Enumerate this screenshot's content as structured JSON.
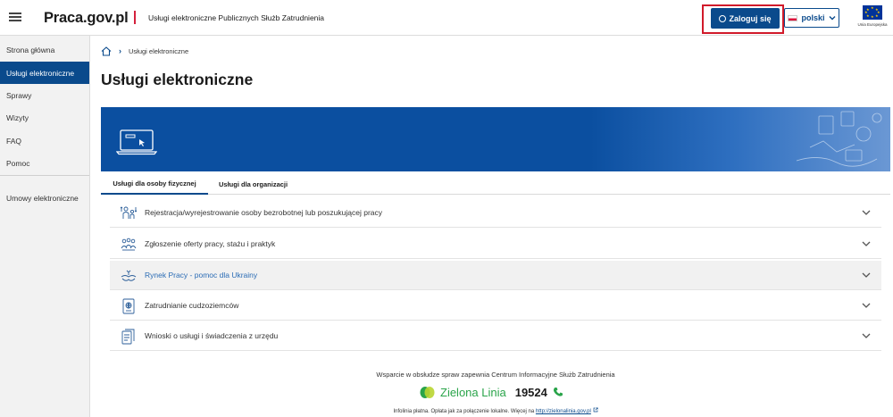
{
  "header": {
    "logo": "Praca.gov.pl",
    "subtitle": "Usługi elektroniczne Publicznych Służb Zatrudnienia",
    "login_label": "Zaloguj się",
    "language_label": "polski",
    "eu_label": "Unia Europejska"
  },
  "sidebar": {
    "items": [
      {
        "label": "Strona główna"
      },
      {
        "label": "Usługi elektroniczne"
      },
      {
        "label": "Sprawy"
      },
      {
        "label": "Wizyty"
      },
      {
        "label": "FAQ"
      },
      {
        "label": "Pomoc"
      },
      {
        "label": "Umowy elektroniczne"
      }
    ],
    "active_index": 1
  },
  "breadcrumb": {
    "current": "Usługi elektroniczne"
  },
  "main": {
    "title": "Usługi elektroniczne",
    "tabs": [
      {
        "label": "Usługi dla osoby fizycznej"
      },
      {
        "label": "Usługi dla organizacji"
      }
    ],
    "active_tab": 0,
    "services": [
      {
        "label": "Rejestracja/wyrejestrowanie osoby bezrobotnej lub poszukującej pracy",
        "icon": "people-arrows-icon"
      },
      {
        "label": "Zgłoszenie oferty pracy, stażu i praktyk",
        "icon": "people-group-icon"
      },
      {
        "label": "Rynek Pracy - pomoc dla Ukrainy",
        "icon": "helping-hands-icon"
      },
      {
        "label": "Zatrudnianie cudzoziemców",
        "icon": "passport-icon"
      },
      {
        "label": "Wnioski o usługi i świadczenia z urzędu",
        "icon": "documents-icon"
      }
    ],
    "highlighted_index": 2
  },
  "footer": {
    "support_text": "Wsparcie w obsłudze spraw zapewnia Centrum Informacyjne Służb Zatrudnienia",
    "hotline_name": "Zielona Linia",
    "hotline_number": "19524",
    "note_text": "Infolinia płatna. Opłata jak za połączenie lokalne. Więcej na",
    "note_link": "http://zielonalinia.gov.pl"
  },
  "colors": {
    "primary": "#0a4a8c",
    "highlight_border": "#d11a2a",
    "green": "#2aa44a"
  }
}
